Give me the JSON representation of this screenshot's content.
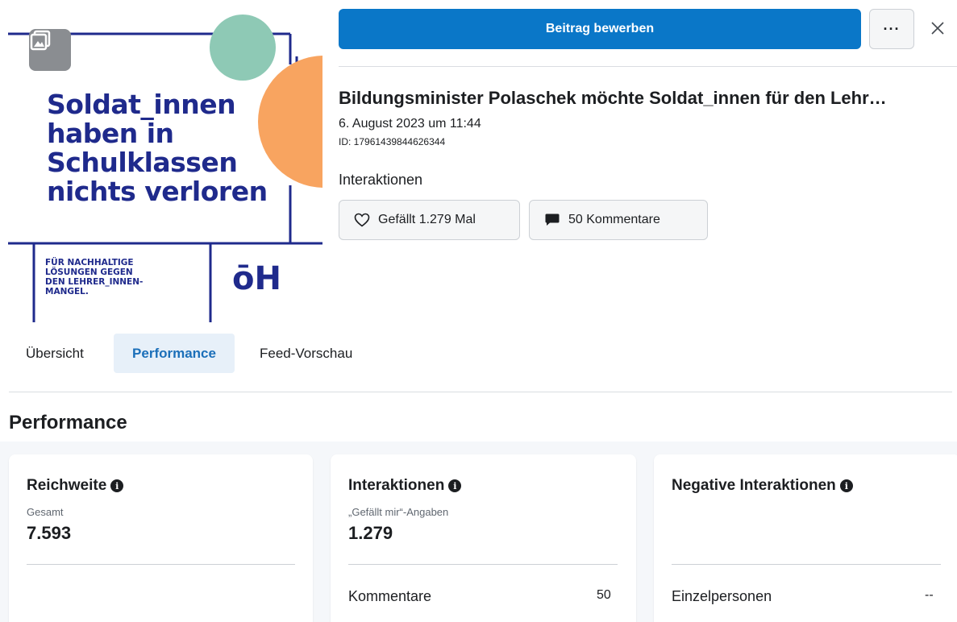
{
  "post_image": {
    "headline_lines": [
      "Soldat_innen",
      "haben in",
      "Schulklassen",
      "nichts verloren"
    ],
    "footer_lines": [
      "FÜR NACHHALTIGE",
      "LÖSUNGEN GEGEN",
      "DEN LEHRER_INNEN-",
      "MANGEL."
    ],
    "logo": "ōH",
    "colors": {
      "navy": "#1f2a8c",
      "teal": "#8ec9b5",
      "orange": "#f8a460"
    }
  },
  "header": {
    "promote_label": "Beitrag bewerben",
    "more_label": "···",
    "close_icon": "close-icon"
  },
  "post": {
    "title": "Bildungsminister Polaschek möchte Soldat_innen für den Lehr…",
    "date": "6. August 2023 um 11:44",
    "id": "ID: 17961439844626344",
    "interactions_label": "Interaktionen",
    "likes_chip": "Gefällt 1.279 Mal",
    "comments_chip": "50 Kommentare"
  },
  "tabs": [
    {
      "label": "Übersicht",
      "active": false
    },
    {
      "label": "Performance",
      "active": true
    },
    {
      "label": "Feed-Vorschau",
      "active": false
    }
  ],
  "section_title": "Performance",
  "cards": [
    {
      "title": "Reichweite",
      "subtitle": "Gesamt",
      "value": "7.593",
      "row_label": "",
      "row_value": ""
    },
    {
      "title": "Interaktionen",
      "subtitle": "„Gefällt mir“-Angaben",
      "value": "1.279",
      "row_label": "Kommentare",
      "row_value": "50"
    },
    {
      "title": "Negative Interaktionen",
      "subtitle": "",
      "value": "",
      "row_label": "Einzelpersonen",
      "row_value": "--"
    }
  ],
  "colors": {
    "accent": "#0a77c8",
    "active_tab_bg": "#e7f0f9",
    "active_tab_text": "#1b6fb9"
  }
}
